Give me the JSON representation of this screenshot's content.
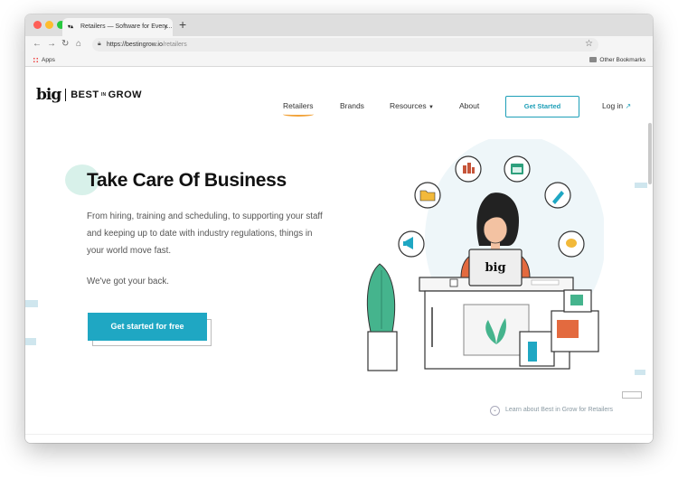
{
  "browser": {
    "tab_title": "Retailers — Software for Every...",
    "tab_close": "×",
    "new_tab": "+",
    "url_host": "https://bestingrow.io",
    "url_path": "/retailers",
    "bookmarks_apps": "Apps",
    "bookmarks_other": "Other Bookmarks",
    "icons": [
      "back-icon",
      "forward-icon",
      "reload-icon",
      "home-icon",
      "lock-icon",
      "star-icon"
    ]
  },
  "site": {
    "logo_mark": "big",
    "logo_word_1": "BEST",
    "logo_word_in": "IN",
    "logo_word_2": "GROW",
    "nav": [
      "Retailers",
      "Brands",
      "Resources",
      "About"
    ],
    "nav_active": "Retailers",
    "cta_top": "Get Started",
    "login": "Log in",
    "accent": "#1fa7c3",
    "underline_color": "#f2a33a"
  },
  "hero": {
    "headline": "Take Care Of Business",
    "paragraph": "From hiring, training and scheduling, to supporting your staff and keeping up to date with industry regulations, things in your world move fast.",
    "tagline": "We've got your back.",
    "cta": "Get started for free",
    "laptop_label": "big",
    "learn_more": "Learn about Best in Grow for Retailers"
  }
}
